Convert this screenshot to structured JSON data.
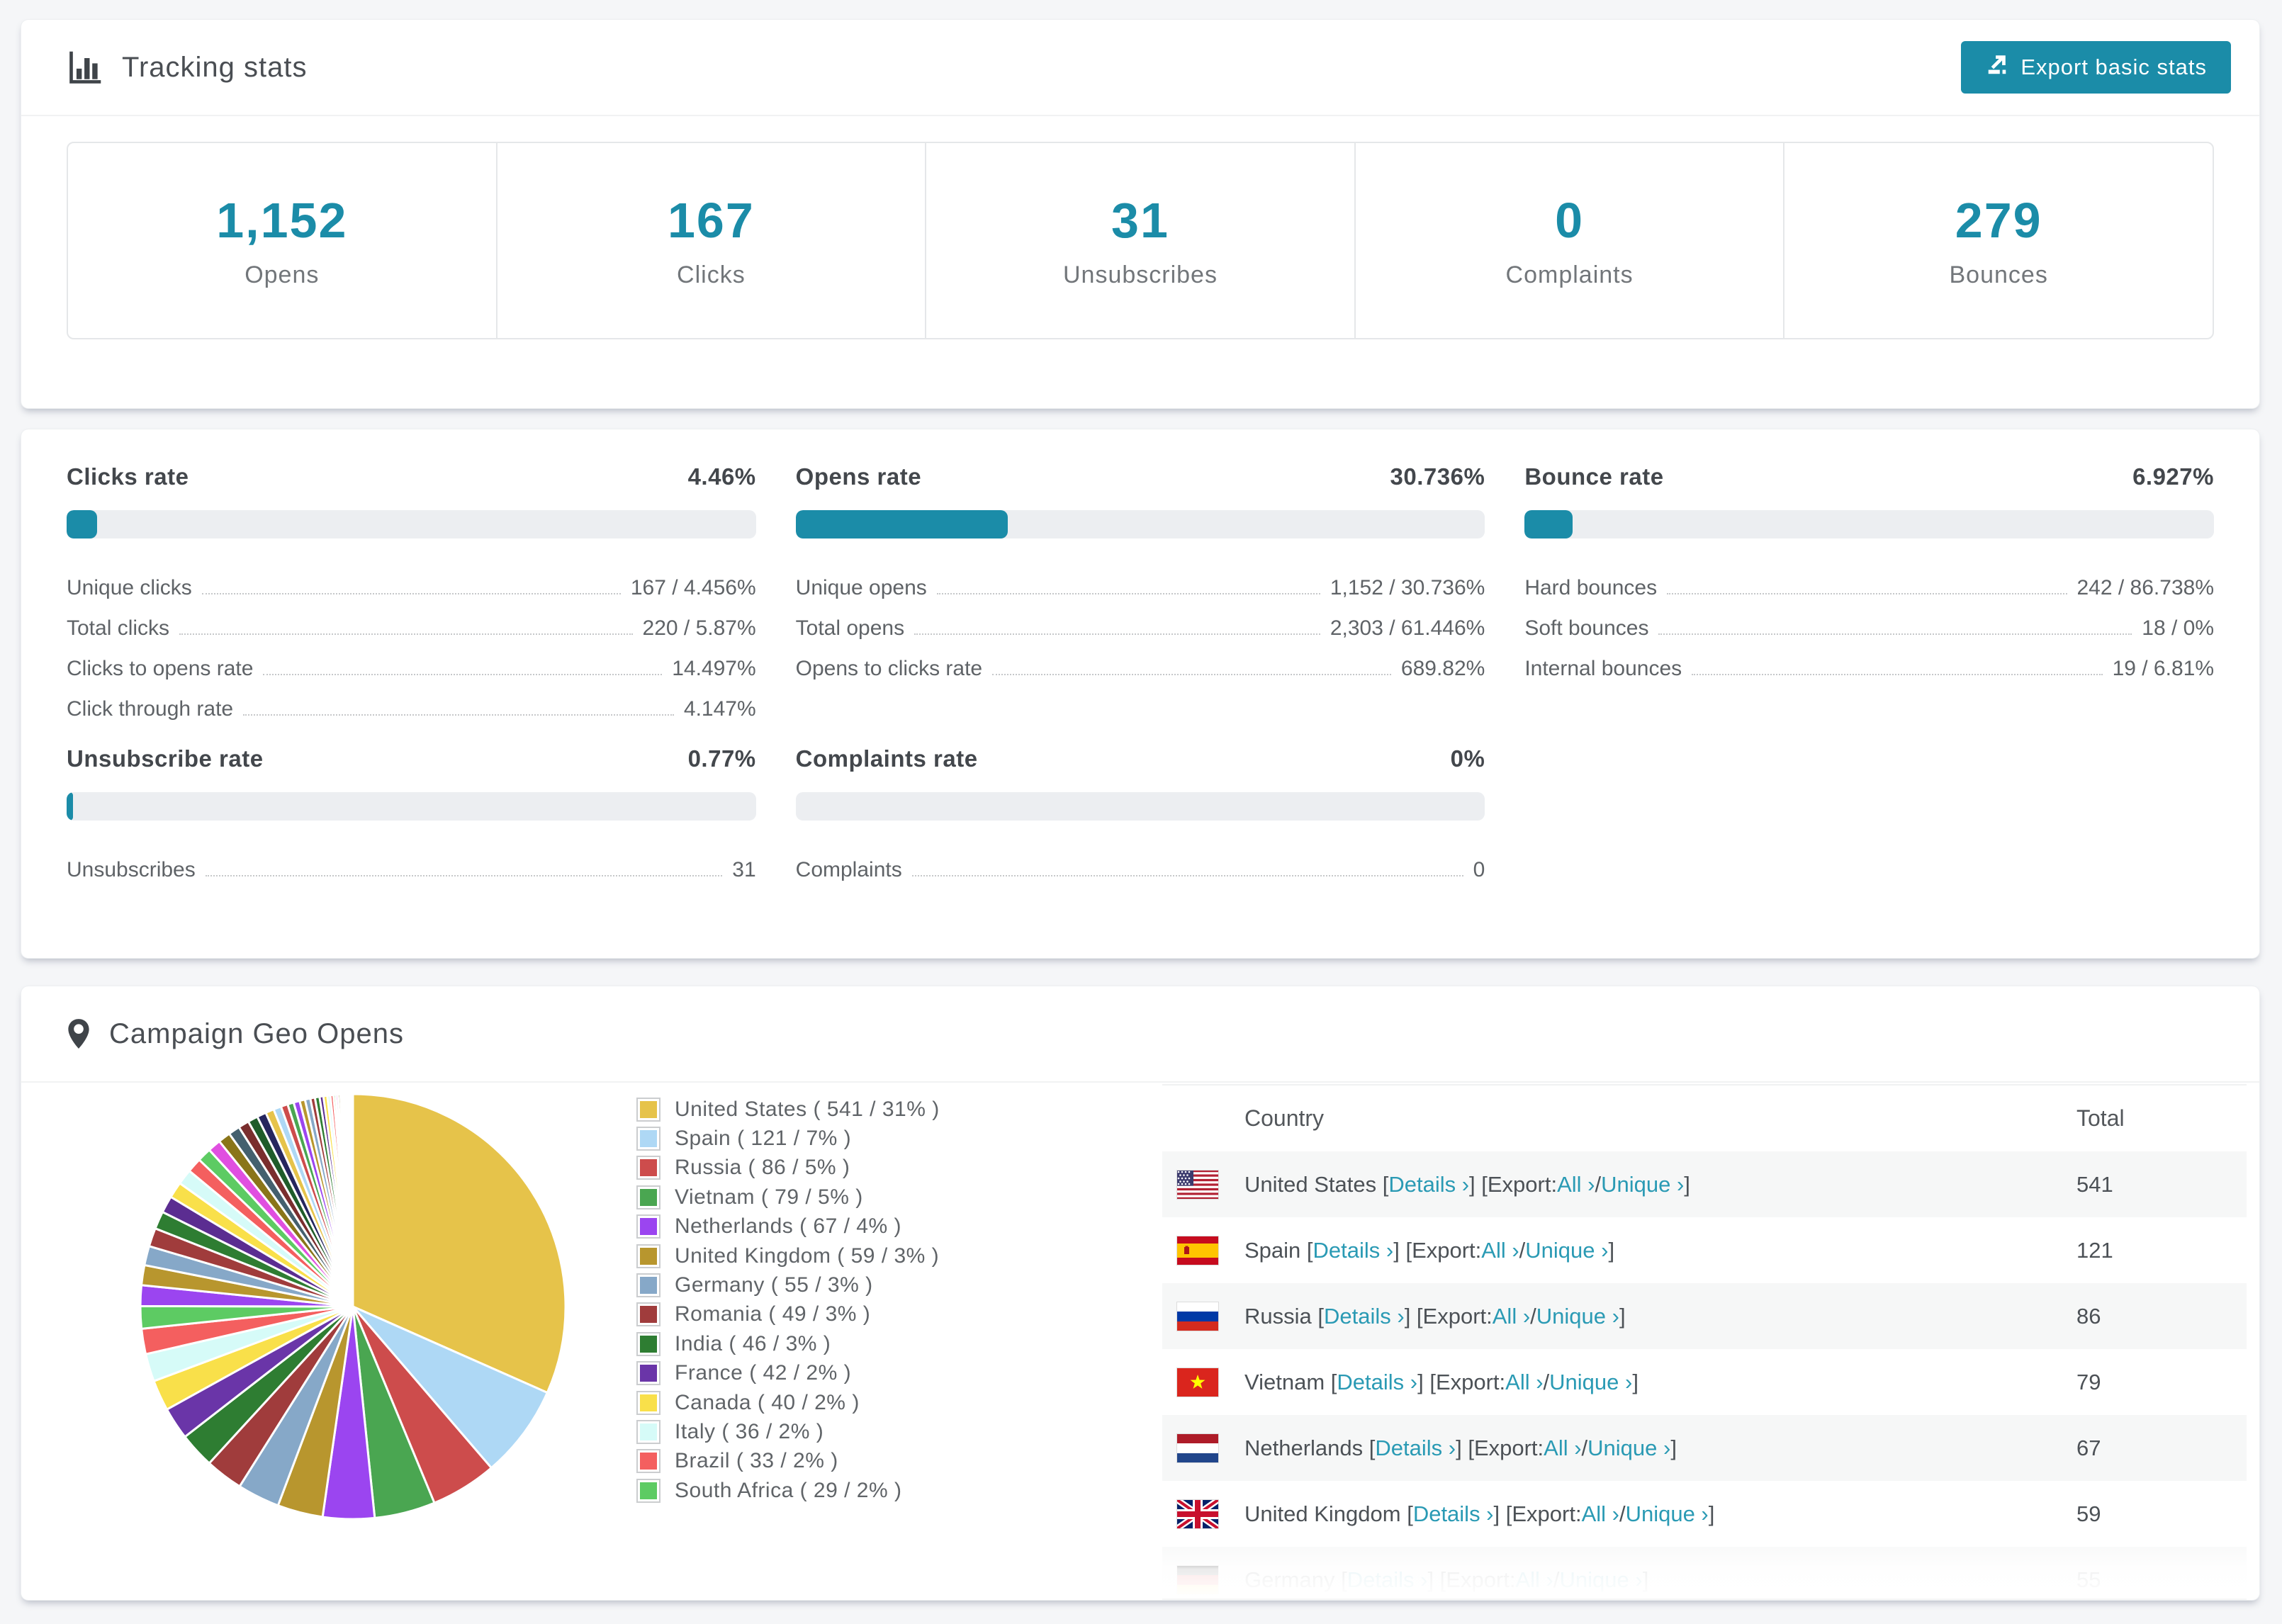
{
  "tracking": {
    "title": "Tracking stats",
    "export_button": "Export basic stats",
    "stats": [
      {
        "label": "Opens",
        "value": "1,152"
      },
      {
        "label": "Clicks",
        "value": "167"
      },
      {
        "label": "Unsubscribes",
        "value": "31"
      },
      {
        "label": "Complaints",
        "value": "0"
      },
      {
        "label": "Bounces",
        "value": "279"
      }
    ]
  },
  "rates": {
    "cards": [
      {
        "title": "Clicks rate",
        "value": "4.46%",
        "progress": 4.46,
        "rows": [
          {
            "label": "Unique clicks",
            "value": "167 / 4.456%"
          },
          {
            "label": "Total clicks",
            "value": "220 / 5.87%"
          },
          {
            "label": "Clicks to opens rate",
            "value": "14.497%"
          },
          {
            "label": "Click through rate",
            "value": "4.147%"
          }
        ]
      },
      {
        "title": "Opens rate",
        "value": "30.736%",
        "progress": 30.736,
        "rows": [
          {
            "label": "Unique opens",
            "value": "1,152 / 30.736%"
          },
          {
            "label": "Total opens",
            "value": "2,303 / 61.446%"
          },
          {
            "label": "Opens to clicks rate",
            "value": "689.82%"
          }
        ]
      },
      {
        "title": "Bounce rate",
        "value": "6.927%",
        "progress": 6.927,
        "rows": [
          {
            "label": "Hard bounces",
            "value": "242 / 86.738%"
          },
          {
            "label": "Soft bounces",
            "value": "18 / 0%"
          },
          {
            "label": "Internal bounces",
            "value": "19 / 6.81%"
          }
        ]
      },
      {
        "title": "Unsubscribe rate",
        "value": "0.77%",
        "progress": 0.77,
        "rows": [
          {
            "label": "Unsubscribes",
            "value": "31"
          }
        ]
      },
      {
        "title": "Complaints rate",
        "value": "0%",
        "progress": 0,
        "rows": [
          {
            "label": "Complaints",
            "value": "0"
          }
        ]
      }
    ]
  },
  "geo": {
    "title": "Campaign Geo Opens",
    "table": {
      "headers": [
        "Country",
        "Total"
      ],
      "link_labels": {
        "details": "Details ›",
        "export_prefix": "[Export: ",
        "all": "All ›",
        "separator": " / ",
        "unique": "Unique ›"
      },
      "rows": [
        {
          "country": "United States",
          "flag": "us",
          "total": "541"
        },
        {
          "country": "Spain",
          "flag": "es",
          "total": "121"
        },
        {
          "country": "Russia",
          "flag": "ru",
          "total": "86"
        },
        {
          "country": "Vietnam",
          "flag": "vn",
          "total": "79"
        },
        {
          "country": "Netherlands",
          "flag": "nl",
          "total": "67"
        },
        {
          "country": "United Kingdom",
          "flag": "gb",
          "total": "59"
        },
        {
          "country": "Germany",
          "flag": "de",
          "total": "55"
        }
      ]
    }
  },
  "chart_data": {
    "type": "pie",
    "title": "Campaign Geo Opens",
    "unit": "opens",
    "legend_position": "right",
    "series": [
      {
        "name": "United States",
        "value": 541,
        "percent": 31,
        "color": "#e6c34a"
      },
      {
        "name": "Spain",
        "value": 121,
        "percent": 7,
        "color": "#aed8f5"
      },
      {
        "name": "Russia",
        "value": 86,
        "percent": 5,
        "color": "#cd4c4c"
      },
      {
        "name": "Vietnam",
        "value": 79,
        "percent": 5,
        "color": "#4aa651"
      },
      {
        "name": "Netherlands",
        "value": 67,
        "percent": 4,
        "color": "#9b45f0"
      },
      {
        "name": "United Kingdom",
        "value": 59,
        "percent": 3,
        "color": "#b8962e"
      },
      {
        "name": "Germany",
        "value": 55,
        "percent": 3,
        "color": "#86a8c8"
      },
      {
        "name": "Romania",
        "value": 49,
        "percent": 3,
        "color": "#a03c3c"
      },
      {
        "name": "India",
        "value": 46,
        "percent": 3,
        "color": "#2e7d32"
      },
      {
        "name": "France",
        "value": 42,
        "percent": 2,
        "color": "#6a35a8"
      },
      {
        "name": "Canada",
        "value": 40,
        "percent": 2,
        "color": "#f9e04a"
      },
      {
        "name": "Italy",
        "value": 36,
        "percent": 2,
        "color": "#d6fbf8"
      },
      {
        "name": "Brazil",
        "value": 33,
        "percent": 2,
        "color": "#f45f5f"
      },
      {
        "name": "South Africa",
        "value": 29,
        "percent": 2,
        "color": "#5dcb63"
      }
    ],
    "others_values": [
      27,
      26,
      25,
      24,
      23,
      22,
      21,
      20,
      19,
      18,
      17,
      16,
      15,
      14,
      13,
      12,
      11,
      10,
      9,
      8,
      8,
      7,
      7,
      6,
      6,
      5,
      5,
      4,
      4,
      3,
      3,
      3,
      2,
      2,
      2,
      2,
      1,
      1,
      1,
      1,
      1,
      1,
      1,
      1
    ],
    "others_palette": [
      "#9b45f0",
      "#b8962e",
      "#86a8c8",
      "#a03c3c",
      "#2e7d32",
      "#5b2d91",
      "#f9e04a",
      "#d6fbf8",
      "#f45f5f",
      "#5dcb63",
      "#e04fe0",
      "#8a7519",
      "#44606e",
      "#7a2e2e",
      "#1f5c2a",
      "#26265e",
      "#e6c34a",
      "#aed8f5",
      "#cd4c4c",
      "#4aa651"
    ]
  },
  "colors": {
    "accent_teal": "#1b8ca8",
    "link_teal": "#2a9ab4",
    "track_gray": "#eceef1"
  }
}
